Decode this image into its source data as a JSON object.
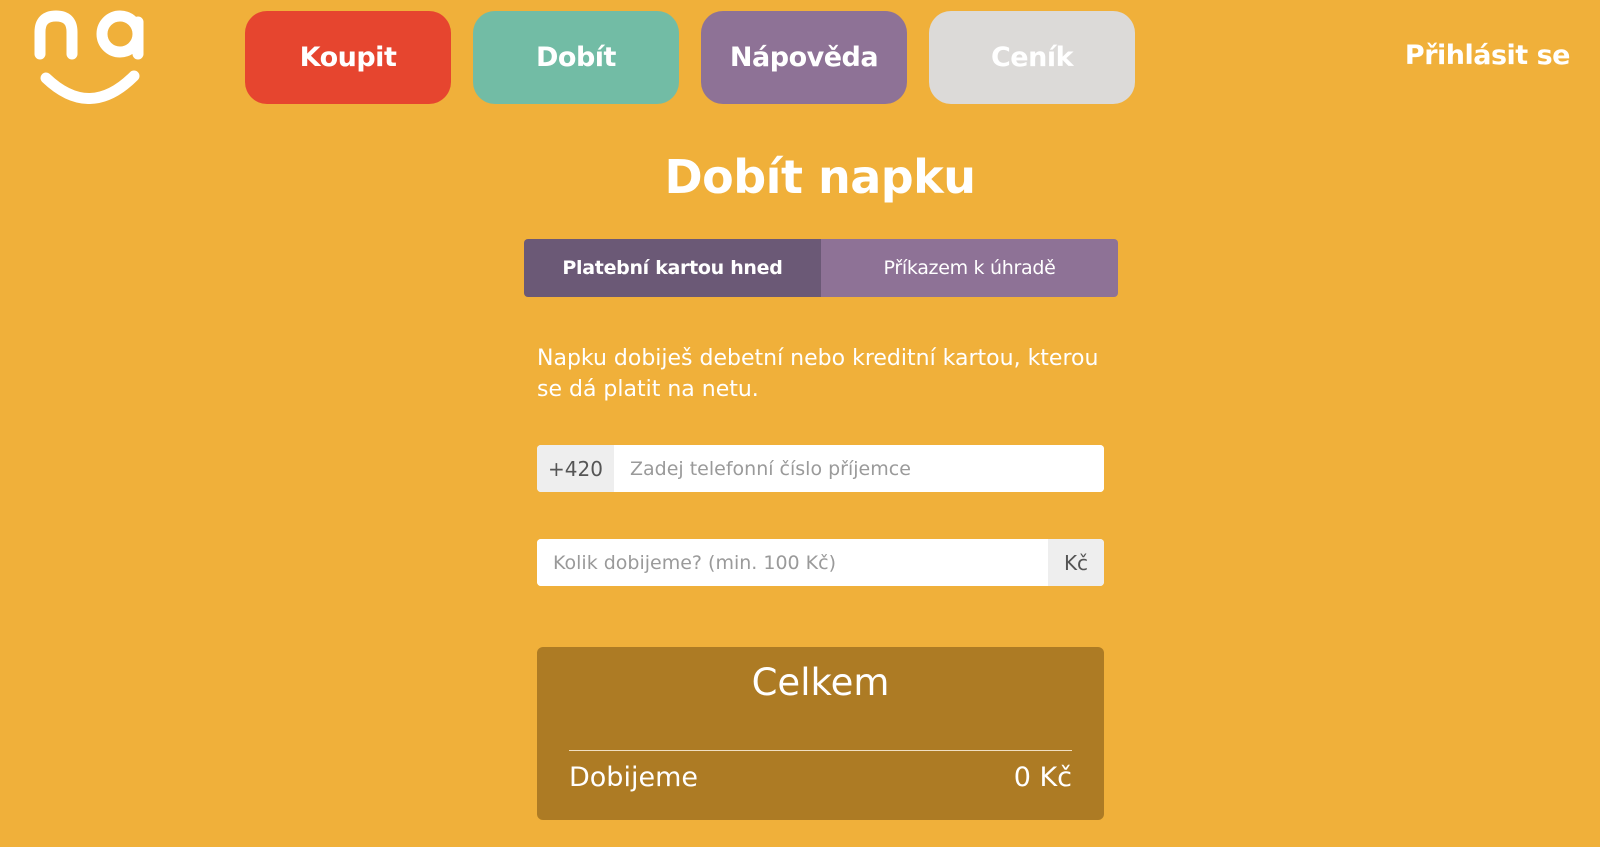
{
  "header": {
    "nav": [
      {
        "label": "Koupit"
      },
      {
        "label": "Dobít"
      },
      {
        "label": "Nápověda"
      },
      {
        "label": "Ceník"
      }
    ],
    "login_label": "Přihlásit se",
    "colors": {
      "background": "#f0b03a",
      "koupit": "#e6452f",
      "dobit": "#72bca5",
      "napoveda": "#8e7296",
      "cenik": "#dcdad8"
    }
  },
  "main": {
    "title": "Dobít napku",
    "tabs": [
      {
        "label": "Platební kartou hned",
        "active": true
      },
      {
        "label": "Příkazem k úhradě",
        "active": false
      }
    ],
    "description": "Napku dobiješ debetní nebo kreditní kartou, kterou se dá platit na netu.",
    "phone": {
      "prefix": "+420",
      "placeholder": "Zadej telefonní číslo příjemce",
      "value": ""
    },
    "amount": {
      "placeholder": "Kolik dobijeme? (min. 100 Kč)",
      "suffix": "Kč",
      "value": ""
    },
    "summary": {
      "title": "Celkem",
      "row_label": "Dobijeme",
      "row_value": "0 Kč"
    }
  }
}
